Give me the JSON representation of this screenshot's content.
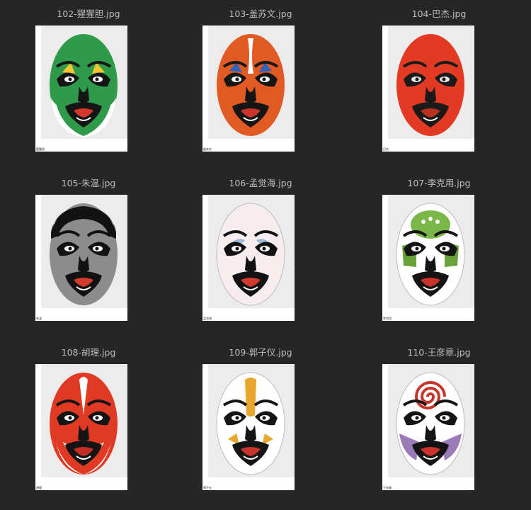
{
  "files": [
    {
      "name": "102-猩猩胆.jpg",
      "caption": "猩猩胆",
      "colors": {
        "main": "#2e9a4a",
        "accent": "#f2c531",
        "dark": "#151515",
        "mouth": "#d4382a",
        "eye": "#ffffff"
      }
    },
    {
      "name": "103-盖苏文.jpg",
      "caption": "盖苏文",
      "colors": {
        "main": "#e25a23",
        "accent": "#2f62b8",
        "dark": "#151515",
        "mouth": "#c9352a",
        "eye": "#ffffff"
      }
    },
    {
      "name": "104-巴杰.jpg",
      "caption": "巴杰",
      "colors": {
        "main": "#e33a24",
        "accent": "#ffffff",
        "dark": "#1a1a1a",
        "mouth": "#b83020",
        "eye": "#e6e6e6"
      }
    },
    {
      "name": "105-朱温.jpg",
      "caption": "朱温",
      "colors": {
        "main": "#8c8c8c",
        "accent": "#e06a3a",
        "dark": "#121212",
        "mouth": "#d33b2d",
        "eye": "#ffffff"
      }
    },
    {
      "name": "106-孟觉海.jpg",
      "caption": "孟觉海",
      "colors": {
        "main": "#f7ecee",
        "accent": "#9fb8d8",
        "dark": "#121212",
        "mouth": "#d33b2d",
        "eye": "#ffffff"
      }
    },
    {
      "name": "107-李克用.jpg",
      "caption": "李克用",
      "colors": {
        "main": "#ffffff",
        "accent": "#6aa33a",
        "dark": "#141414",
        "mouth": "#c8322a",
        "eye": "#ffffff"
      }
    },
    {
      "name": "108-胡理.jpg",
      "caption": "胡理",
      "colors": {
        "main": "#e03a24",
        "accent": "#ffffff",
        "dark": "#141414",
        "mouth": "#c32f24",
        "eye": "#ffffff"
      }
    },
    {
      "name": "109-郭子仪.jpg",
      "caption": "郭子仪",
      "colors": {
        "main": "#ffffff",
        "accent": "#e9a62c",
        "dark": "#151515",
        "mouth": "#c9352a",
        "eye": "#ffffff"
      }
    },
    {
      "name": "110-王彦章.jpg",
      "caption": "王彦章",
      "colors": {
        "main": "#ffffff",
        "accent": "#c7362a",
        "dark": "#141414",
        "mouth": "#c8322a",
        "eye": "#ffffff"
      }
    }
  ]
}
